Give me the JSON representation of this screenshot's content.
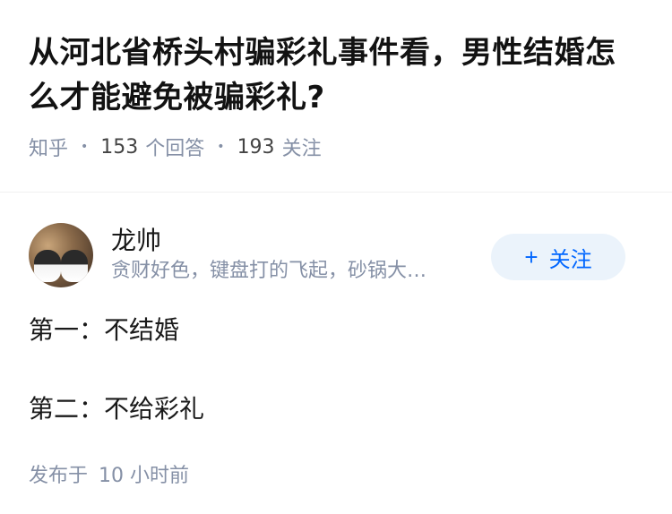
{
  "question": {
    "title": "从河北省桥头村骗彩礼事件看，男性结婚怎么才能避免被骗彩礼?",
    "source": "知乎",
    "answers_count": "153",
    "answers_label": "个回答",
    "followers_count": "193",
    "followers_label": "关注"
  },
  "answer": {
    "author_name": "龙帅",
    "author_bio": "贪财好色，键盘打的飞起，砂锅大…",
    "follow_button": {
      "icon": "+",
      "label": "关注"
    },
    "paragraphs": [
      "第一：不结婚",
      "第二：不给彩礼"
    ],
    "posted_prefix": "发布于",
    "posted_time": "10 小时前"
  },
  "colors": {
    "accent": "#0066ff",
    "follow_bg": "#ebf3fb",
    "meta": "#8590a6"
  }
}
